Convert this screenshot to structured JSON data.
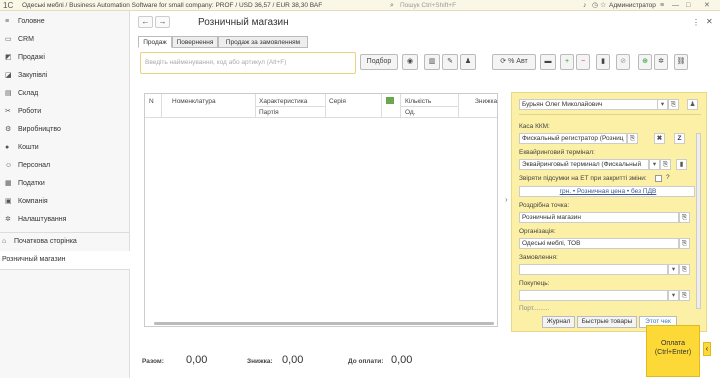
{
  "topbar": {
    "logo": "1C",
    "title": "Одеські меблі / Business Automation Software for small company: PROF / USD 36,57 / EUR 38,30 ВАF",
    "search_placeholder": "Пошук Ctrl+Shift+F",
    "user": "Администратор"
  },
  "sidebar": {
    "items": [
      {
        "icon": "≡",
        "label": "Головне"
      },
      {
        "icon": "▭",
        "label": "CRM"
      },
      {
        "icon": "◩",
        "label": "Продажі"
      },
      {
        "icon": "◪",
        "label": "Закупівлі"
      },
      {
        "icon": "▤",
        "label": "Склад"
      },
      {
        "icon": "✂",
        "label": "Роботи"
      },
      {
        "icon": "⚙",
        "label": "Виробництво"
      },
      {
        "icon": "●",
        "label": "Кошти"
      },
      {
        "icon": "☺",
        "label": "Персонал"
      },
      {
        "icon": "▦",
        "label": "Податки"
      },
      {
        "icon": "▣",
        "label": "Компанія"
      },
      {
        "icon": "✲",
        "label": "Налаштування"
      }
    ],
    "home": {
      "icon": "⌂",
      "label": "Початкова сторінка"
    },
    "open_doc": "Розничный магазин"
  },
  "page": {
    "title": "Розничный магазин",
    "back": "←",
    "forward": "→",
    "tabs": [
      "Продаж",
      "Повернення",
      "Продаж за замовленням"
    ],
    "search_placeholder": "Введіть найменування, код або артикул (Alt+F)",
    "select_label": "Подбор",
    "discount_label": "% Авт",
    "buttons": {
      "eye": "◉",
      "scan": "▥",
      "pencil": "✎",
      "person": "♟",
      "refresh": "⟳",
      "card": "▬",
      "plus": "+",
      "minus": "−",
      "trash": "▮",
      "cancel": "⊘",
      "plus_green": "⊕",
      "gear": "✲",
      "link": "⛓"
    }
  },
  "grid": {
    "headers": {
      "n": "N",
      "nomenclature": "Номенклатура",
      "characteristic": "Характеристика",
      "batch": "Партія",
      "series": "Серія",
      "quantity": "Кількість",
      "unit": "Од.",
      "discount": "Знижка"
    }
  },
  "side": {
    "cashier": "Бурьян Олег Миколайович",
    "kkm_label": "Каса ККМ:",
    "kkm_value": "Фискальный регистратор (Розниц",
    "terminal_label": "Еквайринговий термінал:",
    "terminal_value": "Эквайринговый терминал  (Фискальный",
    "reconcile_label": "Звіряти підсумки на ЕТ при закритті зміни:",
    "reconcile_help": "?",
    "price_link": "грн. • Розничная цена • без ПДВ",
    "store_label": "Роздрібна точка:",
    "store_value": "Розничный магазин",
    "org_label": "Організація:",
    "org_value": "Одеські меблі, ТОВ",
    "order_label": "Замовлення:",
    "order_value": "",
    "buyer_label": "Покупець:",
    "buyer_value": "",
    "more_label": "Порт.........",
    "bottom_tabs": [
      "Журнал",
      "Быстрые товары",
      "Этот чек"
    ]
  },
  "totals": {
    "sum_label": "Разом:",
    "sum_value": "0,00",
    "discount_label": "Знижка:",
    "discount_value": "0,00",
    "pay_label": "До оплати:",
    "pay_value": "0,00"
  },
  "pay_button": {
    "line1": "Оплата",
    "line2": "(Ctrl+Enter)"
  },
  "colors": {
    "accent_yellow": "#fcd936",
    "panel": "#fbf0a6",
    "topbar": "#fbf7e6"
  }
}
